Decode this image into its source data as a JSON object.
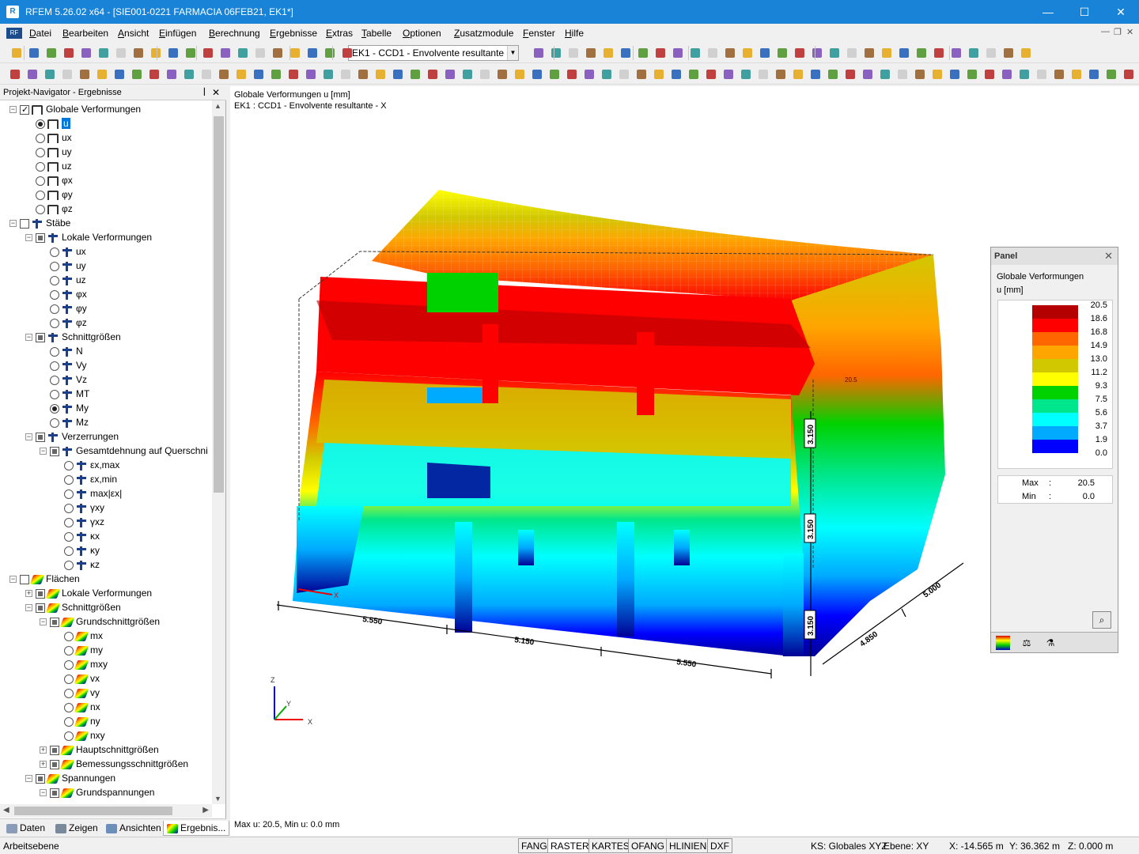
{
  "window": {
    "title": "RFEM 5.26.02 x64 - [SIE001-0221 FARMACIA 06FEB21, EK1*]",
    "min": "—",
    "max": "☐",
    "close": "✕"
  },
  "menu": [
    "Datei",
    "Bearbeiten",
    "Ansicht",
    "Einfügen",
    "Berechnung",
    "Ergebnisse",
    "Extras",
    "Tabelle",
    "Optionen",
    "Zusatzmodule",
    "Fenster",
    "Hilfe"
  ],
  "toolbar": {
    "load_case": "EK1 - CCD1 - Envolvente resultante - X"
  },
  "navigator": {
    "title": "Projekt-Navigator - Ergebnisse",
    "pin": "ꟾ",
    "close": "✕",
    "tree": [
      {
        "t": "Globale Verformungen",
        "lvl": 0,
        "ex": "-",
        "cb": "chk",
        "ic": "frame"
      },
      {
        "t": "u",
        "lvl": 1,
        "rb": "on",
        "ic": "frame",
        "sel": true
      },
      {
        "t": "ux",
        "lvl": 1,
        "rb": "",
        "ic": "frame"
      },
      {
        "t": "uy",
        "lvl": 1,
        "rb": "",
        "ic": "frame"
      },
      {
        "t": "uz",
        "lvl": 1,
        "rb": "",
        "ic": "frame"
      },
      {
        "t": "φx",
        "lvl": 1,
        "rb": "",
        "ic": "frame"
      },
      {
        "t": "φy",
        "lvl": 1,
        "rb": "",
        "ic": "frame"
      },
      {
        "t": "φz",
        "lvl": 1,
        "rb": "",
        "ic": "frame"
      },
      {
        "t": "Stäbe",
        "lvl": 0,
        "ex": "-",
        "cb": "",
        "ic": "beam"
      },
      {
        "t": "Lokale Verformungen",
        "lvl": 1,
        "ex": "-",
        "cb": "part",
        "ic": "beam"
      },
      {
        "t": "ux",
        "lvl": 2,
        "rb": "",
        "ic": "beam"
      },
      {
        "t": "uy",
        "lvl": 2,
        "rb": "",
        "ic": "beam"
      },
      {
        "t": "uz",
        "lvl": 2,
        "rb": "",
        "ic": "beam"
      },
      {
        "t": "φx",
        "lvl": 2,
        "rb": "",
        "ic": "beam"
      },
      {
        "t": "φy",
        "lvl": 2,
        "rb": "",
        "ic": "beam"
      },
      {
        "t": "φz",
        "lvl": 2,
        "rb": "",
        "ic": "beam"
      },
      {
        "t": "Schnittgrößen",
        "lvl": 1,
        "ex": "-",
        "cb": "part",
        "ic": "beam"
      },
      {
        "t": "N",
        "lvl": 2,
        "rb": "",
        "ic": "beam"
      },
      {
        "t": "Vy",
        "lvl": 2,
        "rb": "",
        "ic": "beam"
      },
      {
        "t": "Vz",
        "lvl": 2,
        "rb": "",
        "ic": "beam"
      },
      {
        "t": "MT",
        "lvl": 2,
        "rb": "",
        "ic": "beam"
      },
      {
        "t": "My",
        "lvl": 2,
        "rb": "on",
        "ic": "beam"
      },
      {
        "t": "Mz",
        "lvl": 2,
        "rb": "",
        "ic": "beam"
      },
      {
        "t": "Verzerrungen",
        "lvl": 1,
        "ex": "-",
        "cb": "part",
        "ic": "beam"
      },
      {
        "t": "Gesamtdehnung auf Querschni",
        "lvl": 2,
        "ex": "-",
        "cb": "part",
        "ic": "beam"
      },
      {
        "t": "εx,max",
        "lvl": 3,
        "rb": "",
        "ic": "beam"
      },
      {
        "t": "εx,min",
        "lvl": 3,
        "rb": "",
        "ic": "beam"
      },
      {
        "t": "max|εx|",
        "lvl": 3,
        "rb": "",
        "ic": "beam"
      },
      {
        "t": "γxy",
        "lvl": 3,
        "rb": "",
        "ic": "beam"
      },
      {
        "t": "γxz",
        "lvl": 3,
        "rb": "",
        "ic": "beam"
      },
      {
        "t": "κx",
        "lvl": 3,
        "rb": "",
        "ic": "beam"
      },
      {
        "t": "κy",
        "lvl": 3,
        "rb": "",
        "ic": "beam"
      },
      {
        "t": "κz",
        "lvl": 3,
        "rb": "",
        "ic": "beam"
      },
      {
        "t": "Flächen",
        "lvl": 0,
        "ex": "-",
        "cb": "",
        "ic": "surf"
      },
      {
        "t": "Lokale Verformungen",
        "lvl": 1,
        "ex": "+",
        "cb": "part",
        "ic": "surf"
      },
      {
        "t": "Schnittgrößen",
        "lvl": 1,
        "ex": "-",
        "cb": "part",
        "ic": "surf"
      },
      {
        "t": "Grundschnittgrößen",
        "lvl": 2,
        "ex": "-",
        "cb": "part",
        "ic": "surf"
      },
      {
        "t": "mx",
        "lvl": 3,
        "rb": "",
        "ic": "surf"
      },
      {
        "t": "my",
        "lvl": 3,
        "rb": "",
        "ic": "surf"
      },
      {
        "t": "mxy",
        "lvl": 3,
        "rb": "",
        "ic": "surf"
      },
      {
        "t": "vx",
        "lvl": 3,
        "rb": "",
        "ic": "surf"
      },
      {
        "t": "vy",
        "lvl": 3,
        "rb": "",
        "ic": "surf"
      },
      {
        "t": "nx",
        "lvl": 3,
        "rb": "",
        "ic": "surf"
      },
      {
        "t": "ny",
        "lvl": 3,
        "rb": "",
        "ic": "surf"
      },
      {
        "t": "nxy",
        "lvl": 3,
        "rb": "",
        "ic": "surf"
      },
      {
        "t": "Hauptschnittgrößen",
        "lvl": 2,
        "ex": "+",
        "cb": "part",
        "ic": "surf"
      },
      {
        "t": "Bemessungsschnittgrößen",
        "lvl": 2,
        "ex": "+",
        "cb": "part",
        "ic": "surf"
      },
      {
        "t": "Spannungen",
        "lvl": 1,
        "ex": "-",
        "cb": "part",
        "ic": "surf"
      },
      {
        "t": "Grundspannungen",
        "lvl": 2,
        "ex": "-",
        "cb": "part",
        "ic": "surf"
      }
    ],
    "tabs": [
      "Daten",
      "Zeigen",
      "Ansichten",
      "Ergebnis..."
    ]
  },
  "view": {
    "line1": "Globale Verformungen u [mm]",
    "line2": "EK1 : CCD1 - Envolvente resultante - X",
    "footer": "Max u: 20.5, Min u: 0.0 mm",
    "dims": [
      "5.550",
      "5.150",
      "5.550",
      "4.850",
      "5.000",
      "3.150",
      "3.150",
      "3.150"
    ],
    "max_label": "20.5",
    "axes": {
      "x": "X",
      "y": "Y",
      "z": "Z"
    }
  },
  "panel": {
    "title": "Panel",
    "heading": "Globale Verformungen",
    "unit": "u [mm]",
    "legend": [
      {
        "v": "20.5",
        "c": "#b40000"
      },
      {
        "v": "18.6",
        "c": "#ff0000"
      },
      {
        "v": "16.8",
        "c": "#ff6600"
      },
      {
        "v": "14.9",
        "c": "#ffa500"
      },
      {
        "v": "13.0",
        "c": "#d2c800"
      },
      {
        "v": "11.2",
        "c": "#ffff00"
      },
      {
        "v": "9.3",
        "c": "#00d200"
      },
      {
        "v": "7.5",
        "c": "#00e68c"
      },
      {
        "v": "5.6",
        "c": "#00ffff"
      },
      {
        "v": "3.7",
        "c": "#00aaff"
      },
      {
        "v": "1.9",
        "c": "#0000ff"
      },
      {
        "v": "0.0",
        "c": "#000096"
      }
    ],
    "max_key": "Max",
    "max_val": "20.5",
    "min_key": "Min",
    "min_val": "0.0",
    "colon": ":"
  },
  "status": {
    "left": "Arbeitsebene",
    "toggles": [
      "FANG",
      "RASTER",
      "KARTES",
      "OFANG",
      "HLINIEN",
      "DXF"
    ],
    "ks": "KS: Globales XYZ",
    "ebene": "Ebene: XY",
    "x": "X:  -14.565 m",
    "y": "Y:  36.362 m",
    "z": "Z:   0.000 m"
  }
}
